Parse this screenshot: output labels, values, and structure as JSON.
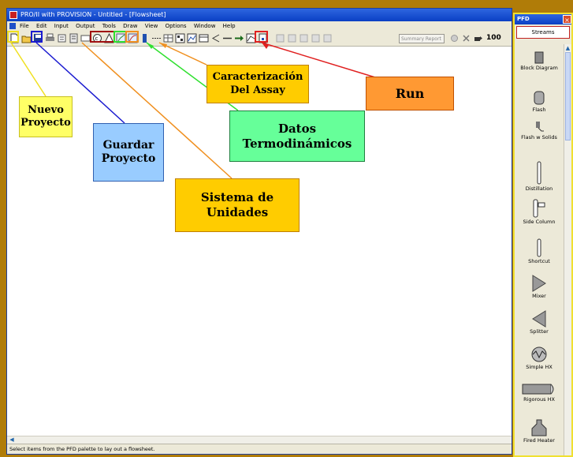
{
  "window": {
    "title": "PRO/II with PROVISION - Untitled - [Flowsheet]",
    "menu": [
      "File",
      "Edit",
      "Input",
      "Output",
      "Tools",
      "Draw",
      "View",
      "Options",
      "Window",
      "Help"
    ],
    "toolbar_text": "100",
    "summary_box": "Summary Report",
    "status": "Select items from the PFD palette to lay out a flowsheet."
  },
  "pfd": {
    "title": "PFD",
    "close": "×",
    "tab": "Streams",
    "items": [
      {
        "label": "Block Diagram",
        "icon": "block-diagram-icon"
      },
      {
        "label": "Flash",
        "icon": "flash-icon"
      },
      {
        "label": "Flash w Solids",
        "icon": "flash-solids-icon"
      },
      {
        "label": "Distillation",
        "icon": "distillation-icon"
      },
      {
        "label": "Side Column",
        "icon": "side-column-icon"
      },
      {
        "label": "Shortcut",
        "icon": "shortcut-icon"
      },
      {
        "label": "Mixer",
        "icon": "mixer-icon"
      },
      {
        "label": "Splitter",
        "icon": "splitter-icon"
      },
      {
        "label": "Simple HX",
        "icon": "simple-hx-icon"
      },
      {
        "label": "Rigorous HX",
        "icon": "rigorous-hx-icon"
      },
      {
        "label": "Fired Heater",
        "icon": "fired-heater-icon"
      }
    ]
  },
  "annotations": {
    "nuevo": "Nuevo Proyecto",
    "guardar": "Guardar Proyecto",
    "sistema": "Sistema de Unidades",
    "datos": "Datos Termodinámicos",
    "caracterizacion": "Caracterización Del Assay",
    "run": "Run"
  },
  "colors": {
    "frame": "#b07c08",
    "nuevo": "#ffff66",
    "guardar": "#99ccff",
    "sistema": "#ffcc00",
    "datos": "#66ff99",
    "caracterizacion": "#ffcc00",
    "run": "#ff9933"
  }
}
